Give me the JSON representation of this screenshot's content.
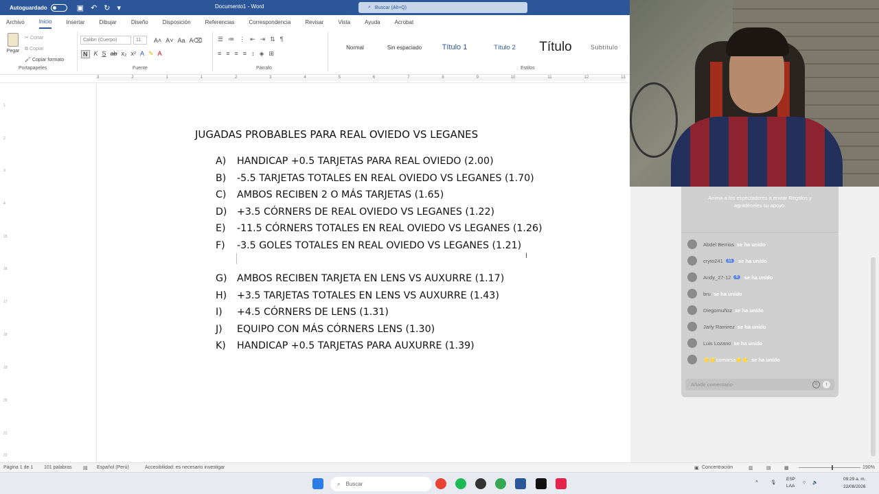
{
  "titlebar": {
    "autosave_label": "Autoguardado",
    "doc_title": "Documento1 - Word",
    "search_placeholder": "Buscar (Alt+Q)"
  },
  "menu": {
    "tabs": [
      "Archivo",
      "Inicio",
      "Insertar",
      "Dibujar",
      "Diseño",
      "Disposición",
      "Referencias",
      "Correspondencia",
      "Revisar",
      "Vista",
      "Ayuda",
      "Acrobat"
    ],
    "active": "Inicio"
  },
  "ribbon": {
    "clipboard": {
      "paste": "Pegar",
      "cut": "Cortar",
      "copy": "Copiar",
      "format_painter": "Copiar formato",
      "group": "Portapapeles"
    },
    "font": {
      "family": "Calibri (Cuerpo)",
      "size": "11",
      "group": "Fuente"
    },
    "paragraph": {
      "group": "Párrafo"
    },
    "styles": {
      "group": "Estilos",
      "items": [
        "Normal",
        "Sin espaciado",
        "Título 1",
        "Título 2",
        "Título",
        "Subtítulo"
      ]
    }
  },
  "ruler": {
    "ticks": [
      "3",
      "2",
      "1",
      "1",
      "2",
      "3",
      "4",
      "5",
      "6",
      "7",
      "8",
      "9",
      "10",
      "11",
      "12",
      "13"
    ]
  },
  "vruler": {
    "ticks": [
      "1",
      "2",
      "3",
      "4",
      "15",
      "16",
      "17",
      "18",
      "19",
      "20",
      "21",
      "22"
    ]
  },
  "document": {
    "heading": "JUGADAS PROBABLES PARA REAL OVIEDO VS LEGANES",
    "picks_group1": [
      {
        "letter": "A)",
        "text": "HANDICAP +0.5 TARJETAS PARA REAL OVIEDO (2.00)"
      },
      {
        "letter": "B)",
        "text": "-5.5 TARJETAS TOTALES EN REAL OVIEDO VS LEGANES (1.70)"
      },
      {
        "letter": "C)",
        "text": "AMBOS RECIBEN 2 O MÁS TARJETAS (1.65)"
      },
      {
        "letter": "D)",
        "text": "+3.5 CÓRNERS DE REAL OVIEDO VS LEGANES (1.22)"
      },
      {
        "letter": "E)",
        "text": "-11.5 CÓRNERS TOTALES EN REAL OVIEDO VS LEGANES (1.26)"
      },
      {
        "letter": "F)",
        "text": "-3.5 GOLES TOTALES EN REAL OVIEDO VS LEGANES (1.21)"
      }
    ],
    "picks_group2": [
      {
        "letter": "G)",
        "text": "AMBOS RECIBEN TARJETA EN LENS VS AUXURRE (1.17)"
      },
      {
        "letter": "H)",
        "text": "+3.5 TARJETAS TOTALES EN LENS VS AUXURRE (1.43)"
      },
      {
        "letter": "I)",
        "text": "+4.5 CÓRNERS DE LENS (1.31)"
      },
      {
        "letter": "J)",
        "text": "EQUIPO CON MÁS CÓRNERS LENS (1.30)"
      },
      {
        "letter": "K)",
        "text": "HANDICAP +0.5 TARJETAS PARA AUXURRE (1.39)"
      }
    ]
  },
  "statusbar": {
    "page": "Página 1 de 1",
    "words": "101 palabras",
    "language": "Español (Perú)",
    "accessibility": "Accesibilidad: es necesario investigar",
    "focus": "Concentración",
    "zoom": "190%"
  },
  "chat": {
    "prompt_line1": "Anima a los espectadores a enviar Regalos y",
    "prompt_line2": "agradéceles su apoyo.",
    "joined_label": "se ha unido",
    "users": [
      {
        "name": "Abdel Berrios",
        "badge": ""
      },
      {
        "name": "cryto241",
        "badge": "11"
      },
      {
        "name": "Andy_27-12",
        "badge": "6"
      },
      {
        "name": "bru",
        "badge": ""
      },
      {
        "name": "Diegomuñoz",
        "badge": ""
      },
      {
        "name": "Jarly Ramirez",
        "badge": ""
      },
      {
        "name": "Luis Lozano",
        "badge": ""
      },
      {
        "name": "⭐⭐comarsa⭐⭐",
        "badge": ""
      }
    ],
    "input_placeholder": "Añadir comentario"
  },
  "taskbar": {
    "search": "Buscar",
    "lang1": "ESP",
    "lang2": "LAA",
    "time": "09:29 a. m.",
    "date": "22/08/2026"
  }
}
